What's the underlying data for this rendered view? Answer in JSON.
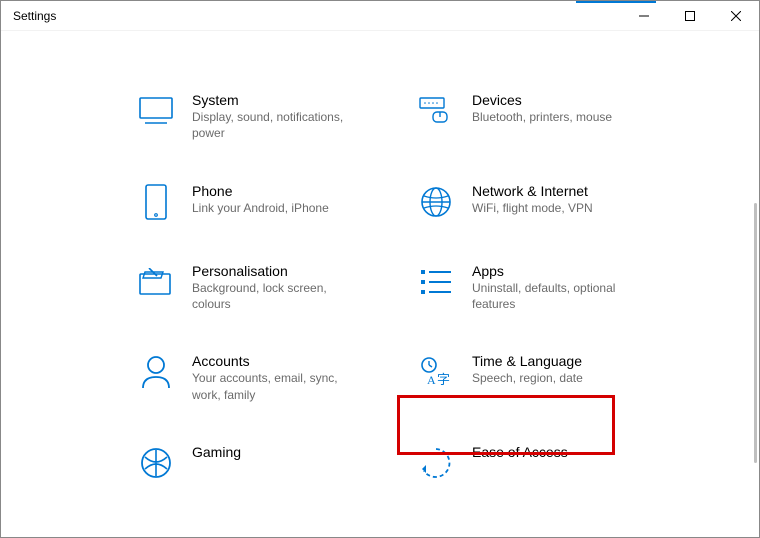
{
  "window": {
    "title": "Settings"
  },
  "categories": [
    {
      "id": "system",
      "title": "System",
      "desc": "Display, sound, notifications, power"
    },
    {
      "id": "devices",
      "title": "Devices",
      "desc": "Bluetooth, printers, mouse"
    },
    {
      "id": "phone",
      "title": "Phone",
      "desc": "Link your Android, iPhone"
    },
    {
      "id": "network",
      "title": "Network & Internet",
      "desc": "WiFi, flight mode, VPN"
    },
    {
      "id": "personalisation",
      "title": "Personalisation",
      "desc": "Background, lock screen, colours"
    },
    {
      "id": "apps",
      "title": "Apps",
      "desc": "Uninstall, defaults, optional features"
    },
    {
      "id": "accounts",
      "title": "Accounts",
      "desc": "Your accounts, email, sync, work, family"
    },
    {
      "id": "time-language",
      "title": "Time & Language",
      "desc": "Speech, region, date"
    },
    {
      "id": "gaming",
      "title": "Gaming",
      "desc": ""
    },
    {
      "id": "ease-of-access",
      "title": "Ease of Access",
      "desc": ""
    }
  ],
  "colors": {
    "accent": "#0078d4",
    "highlight": "#d40000"
  },
  "highlighted_category": "time-language"
}
